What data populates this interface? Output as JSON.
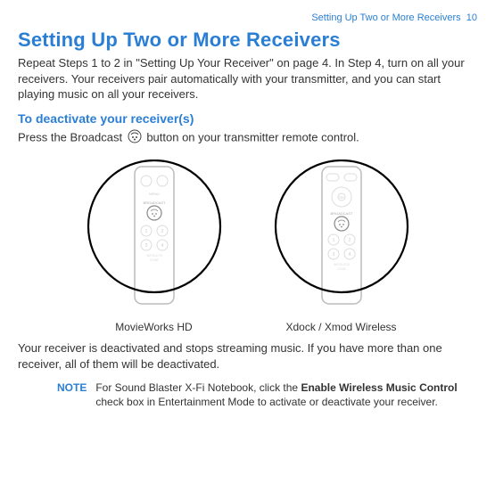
{
  "header": {
    "section": "Setting Up Two or More Receivers",
    "page_no": "10"
  },
  "title": "Setting Up Two or More Receivers",
  "intro": "Repeat Steps 1 to 2 in \"Setting Up Your Receiver\" on page 4. In Step 4, turn on all your receivers. Your receivers pair automatically with your transmitter, and you can start playing music on all your receivers.",
  "subhead": "To deactivate your receiver(s)",
  "press_line_a": "Press the Broadcast",
  "press_line_b": "button on your transmitter remote control.",
  "figures": {
    "left": {
      "caption": "MovieWorks HD"
    },
    "right": {
      "caption": "Xdock / Xmod Wireless"
    }
  },
  "after_fig": "Your receiver is deactivated and stops streaming music. If you have more than one receiver, all of them will be deactivated.",
  "note": {
    "label": "NOTE",
    "text_a": "For Sound Blaster X-Fi Notebook, click the ",
    "bold": "Enable Wireless Music Control",
    "text_b": " check box in Entertainment Mode to activate or deactivate your receiver."
  }
}
